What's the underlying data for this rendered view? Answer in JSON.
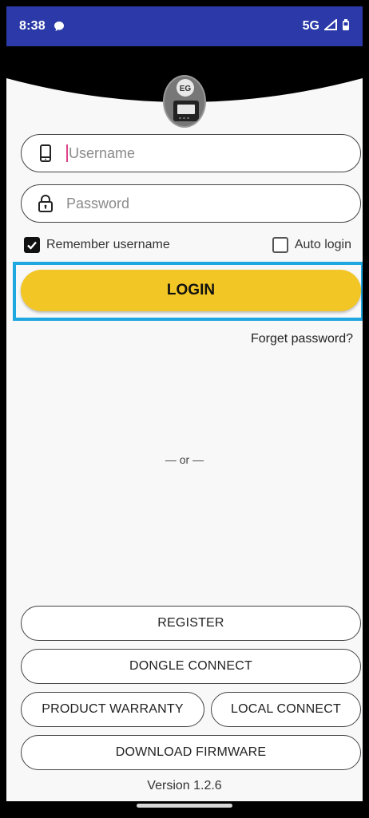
{
  "status": {
    "time": "8:38",
    "network": "5G"
  },
  "login_form": {
    "username_placeholder": "Username",
    "password_placeholder": "Password",
    "remember_label": "Remember username",
    "remember_checked": true,
    "auto_login_label": "Auto login",
    "auto_login_checked": false,
    "login_label": "LOGIN",
    "forget_label": "Forget password?",
    "or_label": "— or —"
  },
  "actions": {
    "register": "REGISTER",
    "dongle_connect": "DONGLE CONNECT",
    "product_warranty": "PRODUCT WARRANTY",
    "local_connect": "LOCAL CONNECT",
    "download_firmware": "DOWNLOAD FIRMWARE"
  },
  "footer": {
    "version": "Version 1.2.6"
  },
  "colors": {
    "status_bar": "#2b3aa8",
    "login_button": "#f2c624",
    "highlight": "#1ea7e1"
  }
}
